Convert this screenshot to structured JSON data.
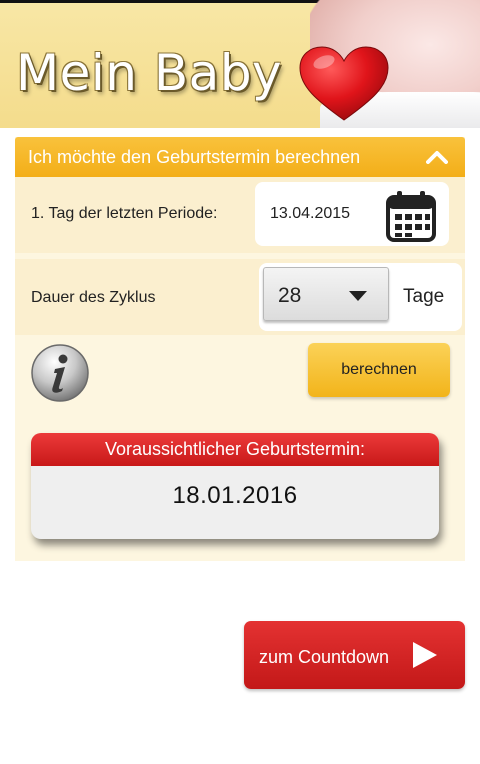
{
  "header": {
    "app_title": "Mein Baby",
    "icon": "heart-icon"
  },
  "calculator": {
    "section_title": "Ich möchte den Geburtstermin berechnen",
    "section_icon": "chevron-up-icon",
    "last_period": {
      "label": "1. Tag der letzten Periode:",
      "value": "13.04.2015",
      "icon": "calendar-icon"
    },
    "cycle": {
      "label": "Dauer des Zyklus",
      "value": "28",
      "unit": "Tage",
      "icon": "dropdown-arrow-icon"
    },
    "info_icon": "info-icon",
    "calculate_label": "berechnen",
    "result": {
      "heading": "Voraussichtlicher Geburtstermin:",
      "date": "18.01.2016"
    }
  },
  "countdown_button": {
    "label": "zum Countdown",
    "icon": "play-icon"
  },
  "colors": {
    "accent_yellow": "#f3ae18",
    "accent_red": "#c81818",
    "card_background": "#fdf6e0",
    "row_background": "#fbefcf",
    "header_background": "#f4dc8c"
  }
}
